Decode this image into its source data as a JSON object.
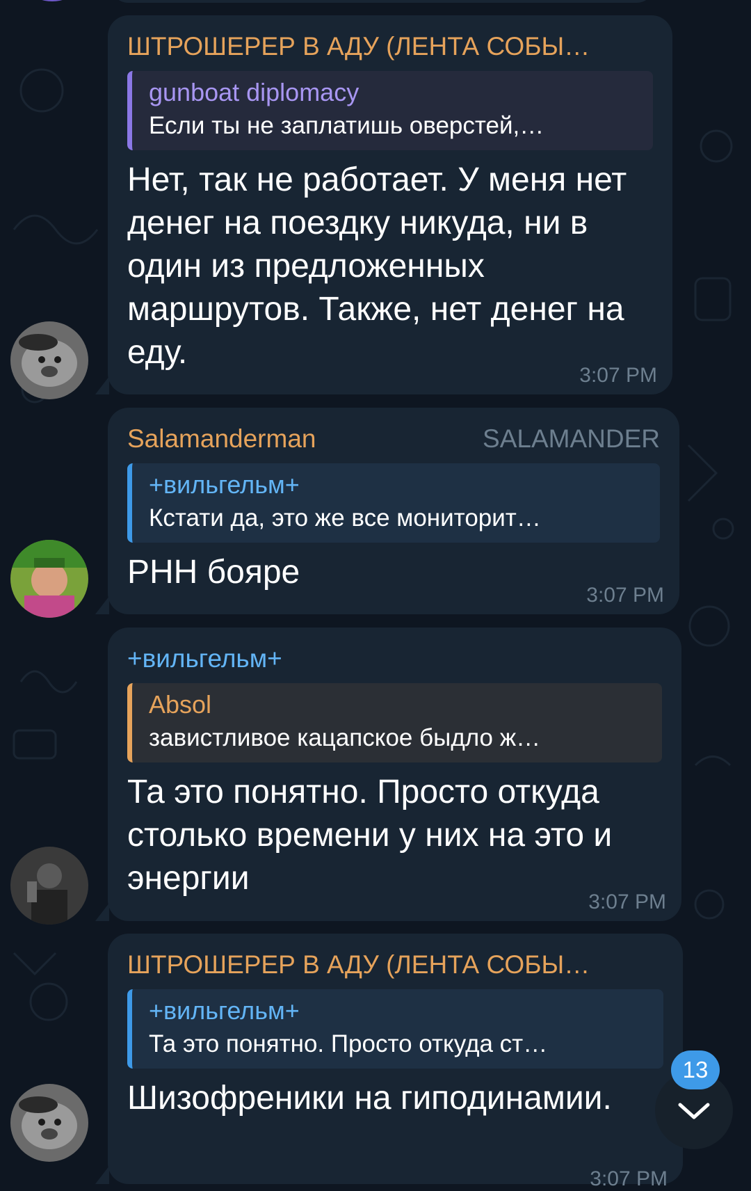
{
  "colors": {
    "background": "#0e1621",
    "bubble": "#182533",
    "time": "#6d7f8f",
    "badge": "#3e9ae8"
  },
  "messages": [
    {
      "sender": "ШТРОШЕРЕР В АДУ (ЛЕНТА СОБЫ…",
      "sender_color": "#e6a35b",
      "reply": {
        "name": "gunboat diplomacy",
        "text": "Если ты не заплатишь оверстей,…",
        "name_color": "#a896f2",
        "bar_color": "#8b78e6",
        "bg": "#252a3c"
      },
      "text": "Нет, так не работает. У меня нет денег на поездку никуда, ни в один из предложенных маршрутов. Также, нет денег на еду.",
      "time": "3:07 PM"
    },
    {
      "sender": "Salamanderman",
      "sender_color": "#e6a35b",
      "role": "SALAMANDER",
      "reply": {
        "name": "+вильгельм+",
        "text": "Кстати да, это же все мониторит…",
        "name_color": "#63b5f6",
        "bar_color": "#3e9ae8",
        "bg": "#1e3044"
      },
      "text": "РНН бояре",
      "time": "3:07 PM"
    },
    {
      "sender": "+вильгельм+",
      "sender_color": "#63b5f6",
      "reply": {
        "name": "Absol",
        "text": "завистливое кацапское быдло ж…",
        "name_color": "#e6a35b",
        "bar_color": "#e6a35b",
        "bg": "#2b2f35"
      },
      "text": "Та это понятно. Просто откуда столько времени у них на это и энергии",
      "time": "3:07 PM"
    },
    {
      "sender": "ШТРОШЕРЕР В АДУ (ЛЕНТА СОБЫ…",
      "sender_color": "#e6a35b",
      "reply": {
        "name": "+вильгельм+",
        "text": "Та это понятно. Просто откуда ст…",
        "name_color": "#63b5f6",
        "bar_color": "#3e9ae8",
        "bg": "#1e3044"
      },
      "text": "Шизофреники на гиподинамии.",
      "time": "3:07 PM"
    }
  ],
  "unread_count": "13",
  "scroll_icon": "chevron-down-icon"
}
